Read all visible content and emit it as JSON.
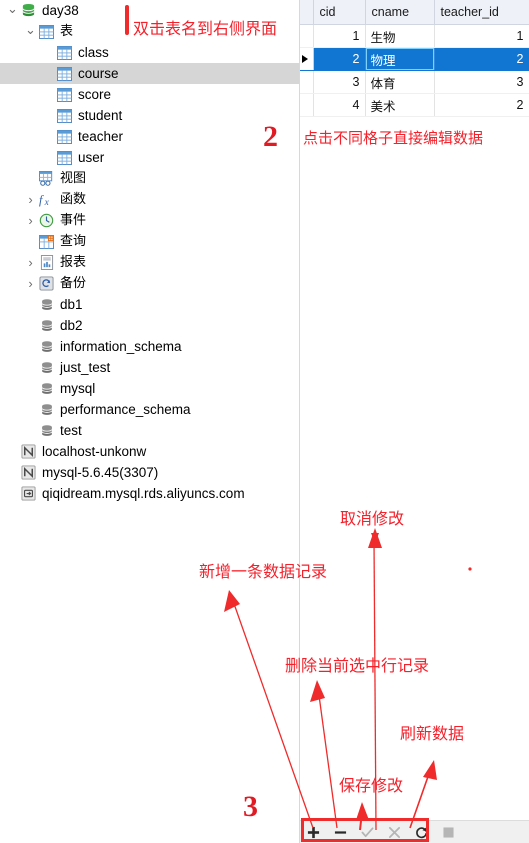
{
  "sidebar": {
    "items": [
      {
        "label": "day38",
        "icon": "database-green-icon",
        "depth": 0,
        "chev": "expanded",
        "selected": false
      },
      {
        "label": "表",
        "icon": "table-folder-icon",
        "depth": 1,
        "chev": "expanded",
        "selected": false,
        "cjk": true
      },
      {
        "label": "class",
        "icon": "table-icon",
        "depth": 2,
        "chev": "none",
        "selected": false
      },
      {
        "label": "course",
        "icon": "table-icon",
        "depth": 2,
        "chev": "none",
        "selected": true
      },
      {
        "label": "score",
        "icon": "table-icon",
        "depth": 2,
        "chev": "none",
        "selected": false
      },
      {
        "label": "student",
        "icon": "table-icon",
        "depth": 2,
        "chev": "none",
        "selected": false
      },
      {
        "label": "teacher",
        "icon": "table-icon",
        "depth": 2,
        "chev": "none",
        "selected": false
      },
      {
        "label": "user",
        "icon": "table-icon",
        "depth": 2,
        "chev": "none",
        "selected": false
      },
      {
        "label": "视图",
        "icon": "view-icon",
        "depth": 1,
        "chev": "none",
        "selected": false,
        "cjk": true
      },
      {
        "label": "函数",
        "icon": "function-fx-icon",
        "depth": 1,
        "chev": "collapsed",
        "selected": false,
        "cjk": true
      },
      {
        "label": "事件",
        "icon": "event-clock-icon",
        "depth": 1,
        "chev": "collapsed",
        "selected": false,
        "cjk": true
      },
      {
        "label": "查询",
        "icon": "query-icon",
        "depth": 1,
        "chev": "none",
        "selected": false,
        "cjk": true
      },
      {
        "label": "报表",
        "icon": "report-icon",
        "depth": 1,
        "chev": "collapsed",
        "selected": false,
        "cjk": true
      },
      {
        "label": "备份",
        "icon": "backup-icon",
        "depth": 1,
        "chev": "collapsed",
        "selected": false,
        "cjk": true
      },
      {
        "label": "db1",
        "icon": "database-gray-icon",
        "depth": 1,
        "chev": "none",
        "selected": false
      },
      {
        "label": "db2",
        "icon": "database-gray-icon",
        "depth": 1,
        "chev": "none",
        "selected": false
      },
      {
        "label": "information_schema",
        "icon": "database-gray-icon",
        "depth": 1,
        "chev": "none",
        "selected": false
      },
      {
        "label": "just_test",
        "icon": "database-gray-icon",
        "depth": 1,
        "chev": "none",
        "selected": false
      },
      {
        "label": "mysql",
        "icon": "database-gray-icon",
        "depth": 1,
        "chev": "none",
        "selected": false
      },
      {
        "label": "performance_schema",
        "icon": "database-gray-icon",
        "depth": 1,
        "chev": "none",
        "selected": false
      },
      {
        "label": "test",
        "icon": "database-gray-icon",
        "depth": 1,
        "chev": "none",
        "selected": false
      },
      {
        "label": "localhost-unkonw",
        "icon": "connection-icon",
        "depth": 0,
        "chev": "none",
        "selected": false
      },
      {
        "label": "mysql-5.6.45(3307)",
        "icon": "connection-icon",
        "depth": 0,
        "chev": "none",
        "selected": false
      },
      {
        "label": "qiqidream.mysql.rds.aliyuncs.com",
        "icon": "connection-cloud-icon",
        "depth": 0,
        "chev": "none",
        "selected": false
      }
    ]
  },
  "grid": {
    "columns": [
      "cid",
      "cname",
      "teacher_id"
    ],
    "rows": [
      {
        "cid": "1",
        "cname": "生物",
        "teacher_id": "1",
        "selected": false,
        "editing": false
      },
      {
        "cid": "2",
        "cname": "物理",
        "teacher_id": "2",
        "selected": true,
        "editing": true
      },
      {
        "cid": "3",
        "cname": "体育",
        "teacher_id": "3",
        "selected": false,
        "editing": false
      },
      {
        "cid": "4",
        "cname": "美术",
        "teacher_id": "2",
        "selected": false,
        "editing": false
      }
    ]
  },
  "navbar": {
    "buttons": [
      {
        "name": "add-record-button",
        "icon": "plus-icon",
        "enabled": true
      },
      {
        "name": "delete-record-button",
        "icon": "minus-icon",
        "enabled": true
      },
      {
        "name": "save-changes-button",
        "icon": "check-icon",
        "enabled": false
      },
      {
        "name": "cancel-changes-button",
        "icon": "cross-icon",
        "enabled": false
      },
      {
        "name": "refresh-data-button",
        "icon": "refresh-icon",
        "enabled": true
      },
      {
        "name": "stop-button",
        "icon": "stop-icon",
        "enabled": false
      }
    ]
  },
  "annotations": {
    "marker_1": "1",
    "marker_2": "2",
    "marker_3": "3",
    "note_double_click": "双击表名到右侧界面",
    "note_click_cell": "点击不同格子直接编辑数据",
    "note_cancel": "取消修改",
    "note_add": "新增一条数据记录",
    "note_delete": "删除当前选中行记录",
    "note_refresh": "刷新数据",
    "note_save": "保存修改"
  },
  "colors": {
    "annotation_red": "#f4212b",
    "selection_blue": "#1076d2",
    "tree_selection_gray": "#d6d6d6",
    "header_blue_gray": "#eef2f8"
  }
}
